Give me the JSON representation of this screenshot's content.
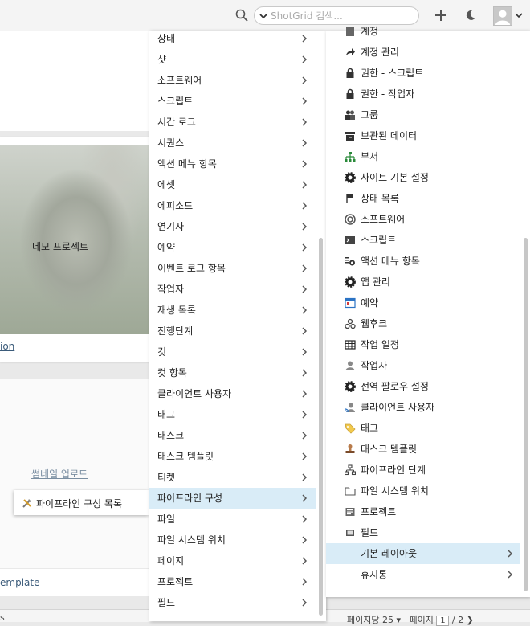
{
  "header": {
    "search_placeholder": "ShotGrid 검색..."
  },
  "background": {
    "thumbnail_label": "데모 프로젝트",
    "card_link": "ion",
    "upload_link": "썸네일 업로드",
    "template_link": "emplate",
    "bottom_left": "s",
    "pagination": {
      "per_page": "페이지당 25",
      "page_label": "페이지",
      "page_current": "1",
      "page_total": "/ 2"
    }
  },
  "submenu": {
    "item_label": "파이프라인 구성 목록"
  },
  "middle_menu": {
    "items": [
      {
        "label": "상태"
      },
      {
        "label": "샷"
      },
      {
        "label": "소프트웨어"
      },
      {
        "label": "스크립트"
      },
      {
        "label": "시간 로그"
      },
      {
        "label": "시퀀스"
      },
      {
        "label": "액션 메뉴 항목"
      },
      {
        "label": "에셋"
      },
      {
        "label": "에피소드"
      },
      {
        "label": "연기자"
      },
      {
        "label": "예약"
      },
      {
        "label": "이벤트 로그 항목"
      },
      {
        "label": "작업자"
      },
      {
        "label": "재생 목록"
      },
      {
        "label": "진행단계"
      },
      {
        "label": "컷"
      },
      {
        "label": "컷 항목"
      },
      {
        "label": "클라이언트 사용자"
      },
      {
        "label": "태그"
      },
      {
        "label": "태스크"
      },
      {
        "label": "태스크 템플릿"
      },
      {
        "label": "티켓"
      },
      {
        "label": "파이프라인 구성"
      },
      {
        "label": "파일"
      },
      {
        "label": "파일 시스템 위치"
      },
      {
        "label": "페이지"
      },
      {
        "label": "프로젝트"
      },
      {
        "label": "필드"
      }
    ],
    "active_index": 22
  },
  "right_menu": {
    "items": [
      {
        "label": "계정",
        "icon": "account-icon"
      },
      {
        "label": "계정 관리",
        "icon": "share-arrow-icon"
      },
      {
        "label": "권한 - 스크립트",
        "icon": "lock-icon"
      },
      {
        "label": "권한 - 작업자",
        "icon": "lock-icon"
      },
      {
        "label": "그룹",
        "icon": "group-icon"
      },
      {
        "label": "보관된 데이터",
        "icon": "archive-icon"
      },
      {
        "label": "부서",
        "icon": "org-chart-icon"
      },
      {
        "label": "사이트 기본 설정",
        "icon": "gear-icon"
      },
      {
        "label": "상태 목록",
        "icon": "flag-icon"
      },
      {
        "label": "소프트웨어",
        "icon": "disc-icon"
      },
      {
        "label": "스크립트",
        "icon": "terminal-icon"
      },
      {
        "label": "액션 메뉴 항목",
        "icon": "menu-gear-icon"
      },
      {
        "label": "앱 관리",
        "icon": "gear-icon"
      },
      {
        "label": "예약",
        "icon": "calendar-icon"
      },
      {
        "label": "웹후크",
        "icon": "webhook-icon"
      },
      {
        "label": "작업 일정",
        "icon": "grid-icon"
      },
      {
        "label": "작업자",
        "icon": "person-icon"
      },
      {
        "label": "전역 팔로우 설정",
        "icon": "gear-icon"
      },
      {
        "label": "클라이언트 사용자",
        "icon": "client-user-icon"
      },
      {
        "label": "태그",
        "icon": "tag-icon"
      },
      {
        "label": "태스크 템플릿",
        "icon": "stamp-icon"
      },
      {
        "label": "파이프라인 단계",
        "icon": "hierarchy-icon"
      },
      {
        "label": "파일 시스템 위치",
        "icon": "folder-icon"
      },
      {
        "label": "프로젝트",
        "icon": "project-icon"
      },
      {
        "label": "필드",
        "icon": "field-icon"
      },
      {
        "label": "기본 레이아웃",
        "icon": ""
      },
      {
        "label": "휴지통",
        "icon": ""
      }
    ],
    "active_index": 25,
    "submenu_indices": [
      25,
      26
    ]
  }
}
